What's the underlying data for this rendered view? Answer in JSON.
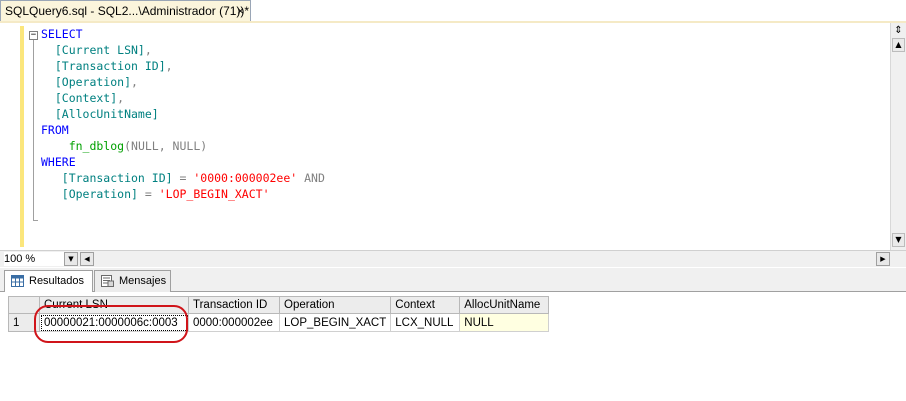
{
  "document_tab": {
    "title": "SQLQuery6.sql - SQL2...\\Administrador (71))*",
    "close_glyph": "×"
  },
  "editor": {
    "collapse_glyph": "−",
    "lines": [
      [
        {
          "t": "SELECT",
          "c": "kw"
        }
      ],
      [
        {
          "t": "  [Current LSN]",
          "c": "teal"
        },
        {
          "t": ",",
          "c": "gray"
        }
      ],
      [
        {
          "t": "  [Transaction ID]",
          "c": "teal"
        },
        {
          "t": ",",
          "c": "gray"
        }
      ],
      [
        {
          "t": "  [Operation]",
          "c": "teal"
        },
        {
          "t": ",",
          "c": "gray"
        }
      ],
      [
        {
          "t": "  [Context]",
          "c": "teal"
        },
        {
          "t": ",",
          "c": "gray"
        }
      ],
      [
        {
          "t": "  [AllocUnitName]",
          "c": "teal"
        }
      ],
      [
        {
          "t": "FROM",
          "c": "kw"
        }
      ],
      [
        {
          "t": "    fn_dblog",
          "c": "fnname"
        },
        {
          "t": "(NULL, NULL)",
          "c": "gray"
        }
      ],
      [
        {
          "t": "WHERE",
          "c": "kw"
        }
      ],
      [
        {
          "t": "   [Transaction ID] ",
          "c": "teal"
        },
        {
          "t": "= ",
          "c": "gray"
        },
        {
          "t": "'0000:000002ee'",
          "c": "str"
        },
        {
          "t": " AND",
          "c": "gray"
        }
      ],
      [
        {
          "t": "   [Operation] ",
          "c": "teal"
        },
        {
          "t": "= ",
          "c": "gray"
        },
        {
          "t": "'LOP_BEGIN_XACT'",
          "c": "str"
        }
      ]
    ]
  },
  "zoom": {
    "value": "100 %"
  },
  "result_tabs": [
    {
      "label": "Resultados",
      "icon": "grid-icon",
      "active": true
    },
    {
      "label": "Mensajes",
      "icon": "messages-icon",
      "active": false
    }
  ],
  "results_grid": {
    "columns": [
      "Current LSN",
      "Transaction ID",
      "Operation",
      "Context",
      "AllocUnitName"
    ],
    "rows": [
      {
        "row_number": "1",
        "cells": [
          "00000021:0000006c:0003",
          "0000:000002ee",
          "LOP_BEGIN_XACT",
          "LCX_NULL",
          "NULL"
        ]
      }
    ]
  },
  "colors": {
    "keyword": "#0000ff",
    "identifier": "#008080",
    "string": "#ff0000",
    "function": "#00a000",
    "annotation": "#d0141a"
  }
}
